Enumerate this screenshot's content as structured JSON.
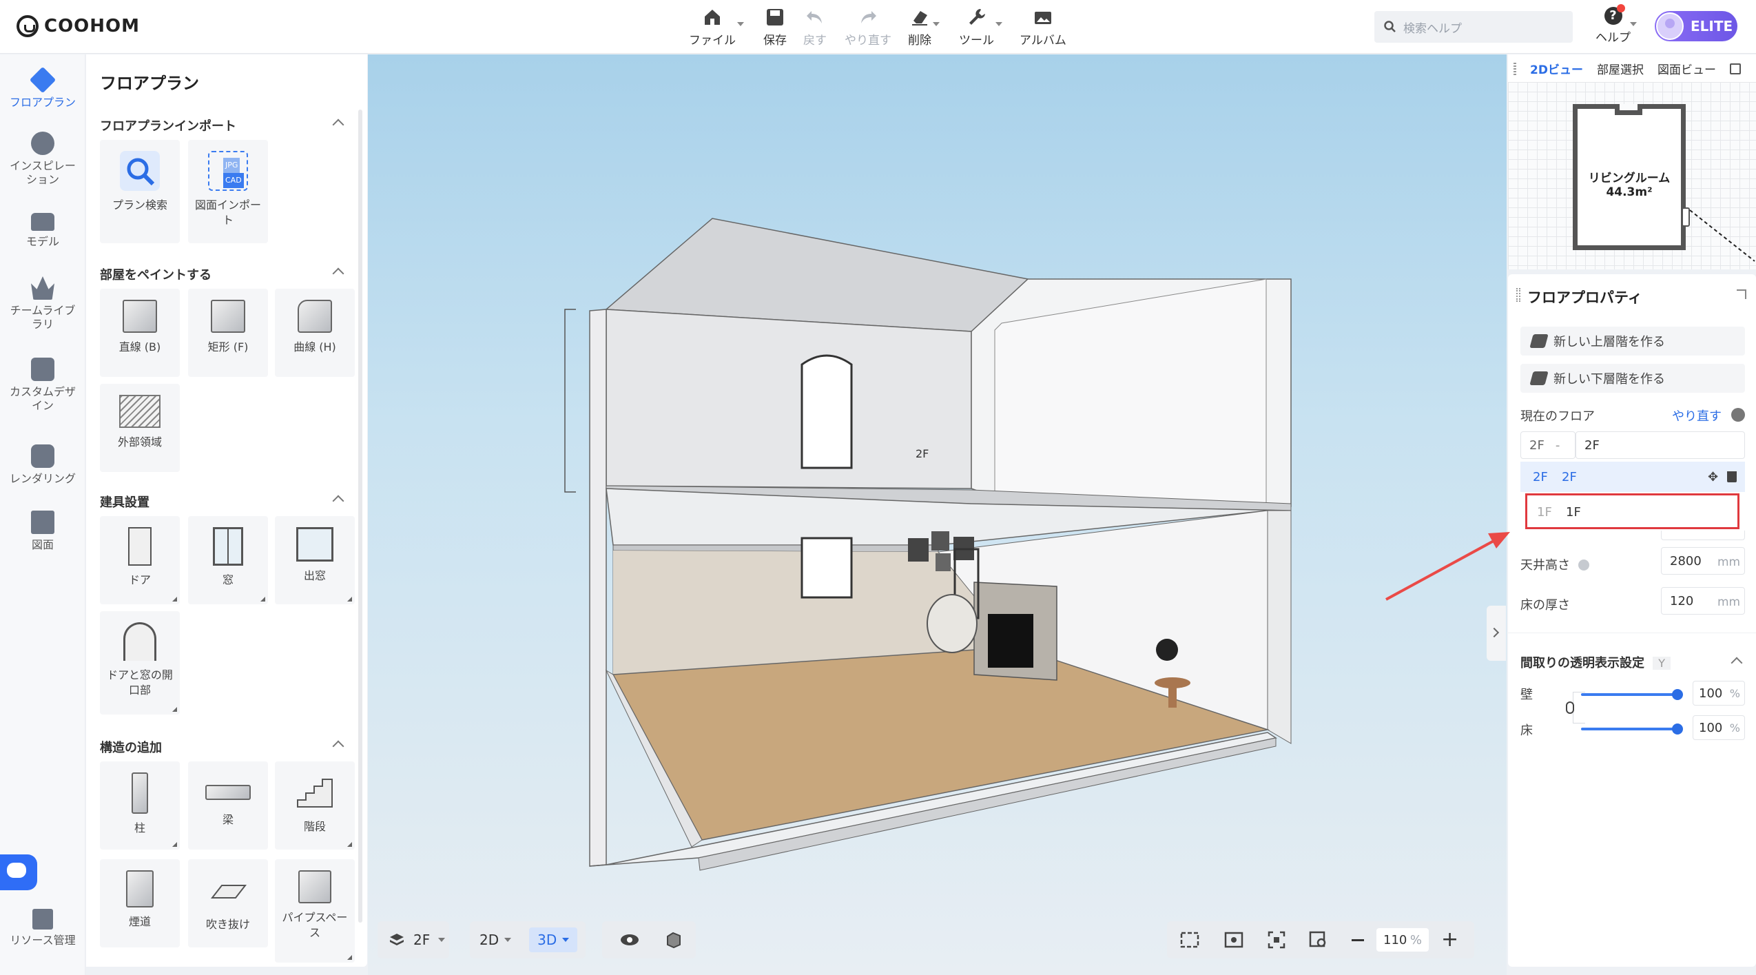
{
  "brand": {
    "name": "COOHOM"
  },
  "toolbar": {
    "file": "ファイル",
    "save": "保存",
    "undo": "戻す",
    "redo": "やり直す",
    "delete": "削除",
    "tools": "ツール",
    "album": "アルバム"
  },
  "search": {
    "placeholder": "検索ヘルプ"
  },
  "help": {
    "label": "ヘルプ"
  },
  "account": {
    "badge": "ELITE"
  },
  "rail": {
    "items": [
      {
        "label": "フロアプラン",
        "icon": "floorplan-icon"
      },
      {
        "label": "インスピレーション",
        "icon": "lightbulb-icon"
      },
      {
        "label": "モデル",
        "icon": "sofa-icon"
      },
      {
        "label": "チームライブラリ",
        "icon": "crown-icon"
      },
      {
        "label": "カスタムデザイン",
        "icon": "custom-design-icon"
      },
      {
        "label": "レンダリング",
        "icon": "camera-icon"
      },
      {
        "label": "図面",
        "icon": "drawing-icon"
      }
    ],
    "resources": "リソース管理"
  },
  "panel": {
    "title": "フロアプラン",
    "sections": {
      "import": {
        "title": "フロアプランインポート",
        "tiles": [
          {
            "label": "プラン検索"
          },
          {
            "label": "図面インポート"
          }
        ],
        "import_badges": [
          "JPG",
          "CAD"
        ]
      },
      "paint": {
        "title": "部屋をペイントする",
        "tiles": [
          {
            "label": "直線 (B)"
          },
          {
            "label": "矩形 (F)"
          },
          {
            "label": "曲線 (H)"
          },
          {
            "label": "外部領域"
          }
        ]
      },
      "fixtures": {
        "title": "建具設置",
        "tiles": [
          {
            "label": "ドア"
          },
          {
            "label": "窓"
          },
          {
            "label": "出窓"
          },
          {
            "label": "ドアと窓の開口部"
          }
        ]
      },
      "structure": {
        "title": "構造の追加",
        "tiles": [
          {
            "label": "柱"
          },
          {
            "label": "梁"
          },
          {
            "label": "階段"
          },
          {
            "label": "煙道"
          },
          {
            "label": "吹き抜け"
          },
          {
            "label": "パイプスペース"
          }
        ]
      }
    }
  },
  "canvas": {
    "floor_height_label": "2F",
    "controls": {
      "floor": "2F",
      "view2d": "2D",
      "view3d": "3D",
      "zoom_value": "110",
      "zoom_unit": "%"
    }
  },
  "minimap": {
    "tabs": [
      "2Dビュー",
      "部屋選択",
      "図面ビュー"
    ],
    "room_name": "リビングルーム",
    "room_area": "44.3m²"
  },
  "floor_props": {
    "title": "フロアプロパティ",
    "add_upper": "新しい上層階を作る",
    "add_lower": "新しい下層階を作る",
    "current_floor_label": "現在のフロア",
    "redo_link": "やり直す",
    "current_code": "2F",
    "current_name": "2F",
    "floors": [
      {
        "code": "2F",
        "name": "2F",
        "selected": true
      },
      {
        "code": "1F",
        "name": "1F",
        "selected": false
      }
    ],
    "ceiling_label": "天井高さ",
    "ceiling_value": "2800",
    "floor_thickness_label": "床の厚さ",
    "floor_thickness_value": "120",
    "unit_mm": "mm",
    "transparency_title": "間取りの透明表示設定",
    "transparency_key": "Y",
    "wall_label": "壁",
    "wall_value": "100",
    "floor_label": "床",
    "floor_value": "100",
    "percent": "%"
  },
  "colors": {
    "accent": "#2b6de5",
    "highlight": "#e0393e",
    "elite": "#7a63ee"
  }
}
